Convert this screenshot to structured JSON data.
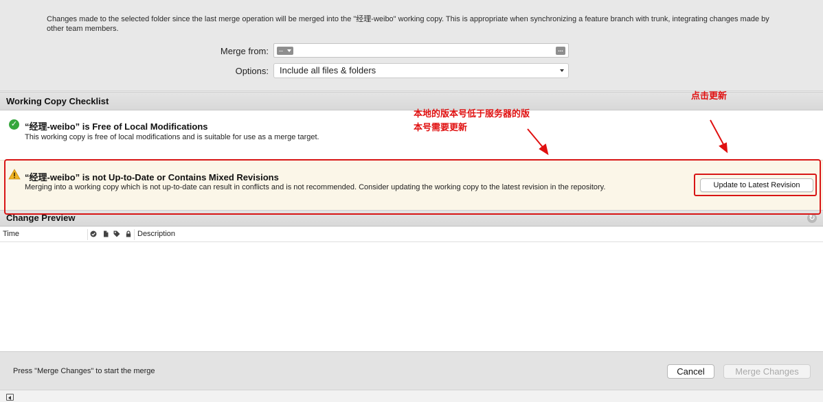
{
  "options_panel": {
    "description": "Changes made to the selected folder since the last merge operation will be merged into the \"经理-weibo\" working copy. This is appropriate when synchronizing a feature branch with trunk, integrating changes made by other team members.",
    "merge_from_label": "Merge from:",
    "merge_from_value": "",
    "history_popup_label": "--",
    "browse_label": "...",
    "options_label": "Options:",
    "options_value": "Include all files & folders"
  },
  "checklist": {
    "header": "Working Copy Checklist",
    "items": [
      {
        "status": "ok",
        "title": "“经理-weibo” is Free of Local Modifications",
        "description": "This working copy is free of local modifications and is suitable for use as a merge target.",
        "status_color": "#35a63d"
      },
      {
        "status": "warning",
        "title": "“经理-weibo” is not Up-to-Date or Contains Mixed Revisions",
        "description": "Merging into a working copy which is not up-to-date can result in conflicts and is not recommended. Consider updating the working copy to the latest revision in the repository.",
        "action_label": "Update to Latest Revision",
        "status_color": "#e8a317"
      }
    ]
  },
  "change_preview": {
    "header": "Change Preview",
    "columns": {
      "time": "Time",
      "description": "Description"
    },
    "column_icons": [
      "checkmark-icon",
      "document-icon",
      "tag-icon",
      "lock-icon"
    ],
    "rows": []
  },
  "footer": {
    "status_text": "Press \"Merge Changes\" to start the merge",
    "cancel_label": "Cancel",
    "merge_label": "Merge Changes"
  },
  "annotations": {
    "note": "本地的版本号低于服务器的版本号需要更新",
    "click_hint": "点击更新",
    "color": "#e01010"
  }
}
